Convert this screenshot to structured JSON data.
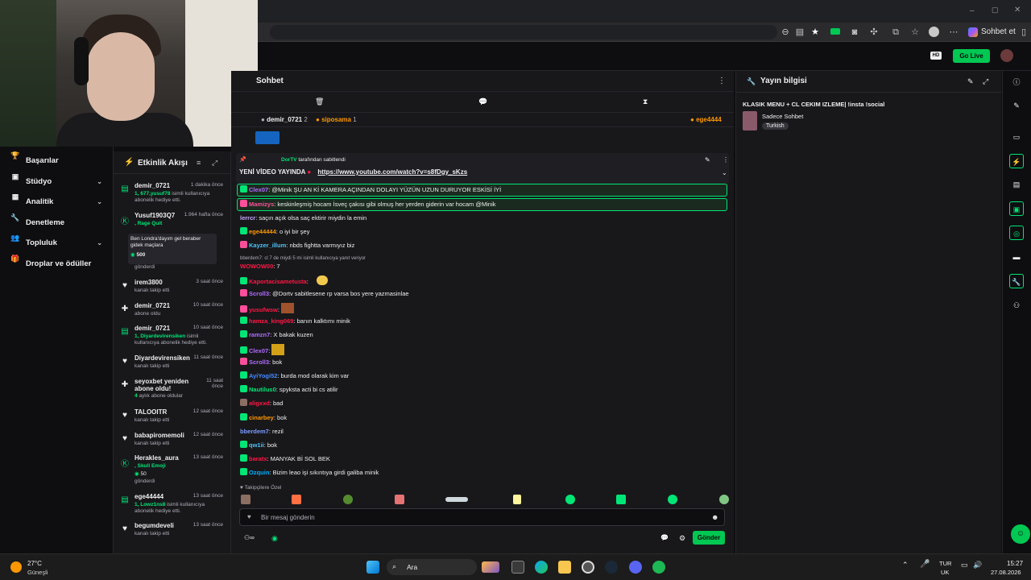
{
  "browser": {
    "profile_label": "Sohbet et"
  },
  "dashboard": {
    "go_live": "Go Live"
  },
  "nav": [
    {
      "label": "Başarılar",
      "icon": "trophy-icon",
      "chevron": false
    },
    {
      "label": "Stüdyo",
      "icon": "camera-icon",
      "chevron": true
    },
    {
      "label": "Analitik",
      "icon": "chart-icon",
      "chevron": true
    },
    {
      "label": "Denetleme",
      "icon": "wrench-icon",
      "chevron": false
    },
    {
      "label": "Topluluk",
      "icon": "people-icon",
      "chevron": true
    },
    {
      "label": "Droplar ve ödüller",
      "icon": "gift-icon",
      "chevron": false
    }
  ],
  "feed": {
    "title": "Etkinlik Akışı",
    "items": [
      {
        "name": "demir_0721",
        "time": "1 dakika önce",
        "hl": "1, 677,yusuf78",
        "sub": "isimli kullanıcıya abonelik hediye etti.",
        "icon": "sub-icon"
      },
      {
        "name": "Yusuf1903Q7",
        "time": "1.964 hafta önce",
        "hl": ", Rage Quit",
        "sub": "",
        "icon": "kick-icon"
      },
      {
        "name": "irem3800",
        "time": "3 saat önce",
        "hl": "",
        "sub": "kanalı takip etti",
        "icon": "heart-icon"
      },
      {
        "name": "demir_0721",
        "time": "10 saat önce",
        "hl": "",
        "sub": "abone oldu",
        "icon": "star-icon"
      },
      {
        "name": "demir_0721",
        "time": "10 saat önce",
        "hl": "1, Diyardevirensiken",
        "sub": "isimli kullanıcıya abonelik hediye etti.",
        "icon": "sub-icon"
      },
      {
        "name": "Diyardevirensiken",
        "time": "11 saat önce",
        "hl": "",
        "sub": "kanalı takip etti",
        "icon": "heart-icon"
      },
      {
        "name": "seyoxbet yeniden abone oldu!",
        "time": "11 saat önce",
        "hl": "4",
        "sub": "aylık abone oldular",
        "icon": "star-icon"
      },
      {
        "name": "TALOOITR",
        "time": "12 saat önce",
        "hl": "",
        "sub": "kanalı takip etti",
        "icon": "heart-icon"
      },
      {
        "name": "babapiromemoli",
        "time": "12 saat önce",
        "hl": "",
        "sub": "kanalı takip etti",
        "icon": "heart-icon"
      },
      {
        "name": "Herakles_aura",
        "time": "13 saat önce",
        "hl": ", Skull Emoji",
        "sub": "",
        "icon": "kick-icon"
      },
      {
        "name": "ege44444",
        "time": "13 saat önce",
        "hl": "1, Lowz1ns8",
        "sub": "isimli kullanıcıya abonelik hediye etti.",
        "icon": "sub-icon"
      },
      {
        "name": "begumdeveli",
        "time": "13 saat önce",
        "hl": "",
        "sub": "kanalı takip etti",
        "icon": "heart-icon"
      }
    ],
    "redeem1": {
      "text": "Ben Londra'dayım gel beraber gidek maçlara",
      "points": "500",
      "sent": "gönderdi"
    },
    "redeem2": {
      "points": "50",
      "sent": "gönderdi"
    }
  },
  "chat": {
    "title": "Sohbet",
    "users": [
      {
        "name": "demir_0721",
        "count": "2"
      },
      {
        "name": "siposama",
        "count": "1"
      },
      {
        "name": "ege4444",
        "count": ""
      }
    ],
    "pinned": {
      "by": "DorTV",
      "by_suffix": "tarafından sabitlendi",
      "text": "YENİ VİDEO YAYINDA",
      "link": "https://www.youtube.com/watch?v=s8fDgy_sKzs"
    },
    "messages": [
      {
        "user": "Clex07",
        "color": "#b26cff",
        "text": ": @Minik ŞU AN Kİ KAMERA AÇINDAN DOLAYI YÜZÜN UZUN DURUYOR ESKİSİ İYİ",
        "highlight": true
      },
      {
        "user": "Mamizys",
        "color": "#ff4f9a",
        "text": ": keskinleşmiş hocam İsveç çakısı gibi olmuş her yerden giderin var hocam @Minik",
        "highlight": true
      },
      {
        "user": "lerrcr",
        "color": "#c7a4ff",
        "text": ": saçın açık olsa saç ektirir miydin la emin",
        "highlight": false
      },
      {
        "user": "ege44444",
        "color": "#ff9800",
        "text": ": o iyi bir şey",
        "highlight": false
      },
      {
        "user": "Kayzer_illum",
        "color": "#4fc3f7",
        "text": ": nbds fightta varmıyız biz",
        "highlight": false
      },
      {
        "user": "WOWOW00",
        "color": "#ff1744",
        "text": ": 7",
        "highlight": false
      },
      {
        "user": "Kaportacisametusta",
        "color": "#ff1744",
        "text": ":",
        "highlight": false
      },
      {
        "user": "Scroll3",
        "color": "#b26cff",
        "text": ": @Dortv sabitlesene rp varsa bos yere yazmasinlae",
        "highlight": false
      },
      {
        "user": "yusufwsw",
        "color": "#ff1744",
        "text": ":",
        "highlight": false
      },
      {
        "user": "hamza_king069",
        "color": "#ff1744",
        "text": ": banın kalktımı minik",
        "highlight": false
      },
      {
        "user": "ramzn7",
        "color": "#b26cff",
        "text": ": X bakak kuzen",
        "highlight": false
      },
      {
        "user": "Clex07",
        "color": "#b26cff",
        "text": ":",
        "highlight": false
      },
      {
        "user": "Scroll3",
        "color": "#b26cff",
        "text": ": bok",
        "highlight": false
      },
      {
        "user": "AyiYogi52",
        "color": "#448aff",
        "text": ": burda mod olarak kim var",
        "highlight": false
      },
      {
        "user": "Nautilus0",
        "color": "#00e676",
        "text": ": spyksta acti bi cs atilir",
        "highlight": false
      },
      {
        "user": "aligxxd",
        "color": "#ff1744",
        "text": ": bad",
        "highlight": false
      },
      {
        "user": "cinarbey",
        "color": "#ff9800",
        "text": ": bok",
        "highlight": false
      },
      {
        "user": "bberdem7",
        "color": "#7c9cff",
        "text": ": rezil",
        "highlight": false
      },
      {
        "user": "qw1ii",
        "color": "#4fc3f7",
        "text": ": bok",
        "highlight": false
      },
      {
        "user": "baratx",
        "color": "#ff1744",
        "text": ": MANYAK Bİ SOL BEK",
        "highlight": false
      },
      {
        "user": "Ozquin",
        "color": "#00b0ff",
        "text": ": Bizim leao işi sıkıntıya girdi galiba minik",
        "highlight": false
      }
    ],
    "system_line": "bberdem7: cl 7 de miydi 5 mi isimli kullanıcıya yanıt veriyor",
    "followers_only": "Takipçilere Özel",
    "input_placeholder": "Bir mesaj gönderin",
    "send": "Gönder"
  },
  "info": {
    "title": "Yayın bilgisi",
    "stream_title": "KLASIK MENU + CL CEKIM IZLEME| !insta !social",
    "category": "Sadece Sohbet",
    "language": "Turkish"
  },
  "taskbar": {
    "weather_temp": "27°C",
    "weather_desc": "Güneşli",
    "search": "Ara",
    "lang1": "TUR",
    "lang2": "UK",
    "time": "15:27",
    "date": "27.08.2026"
  }
}
